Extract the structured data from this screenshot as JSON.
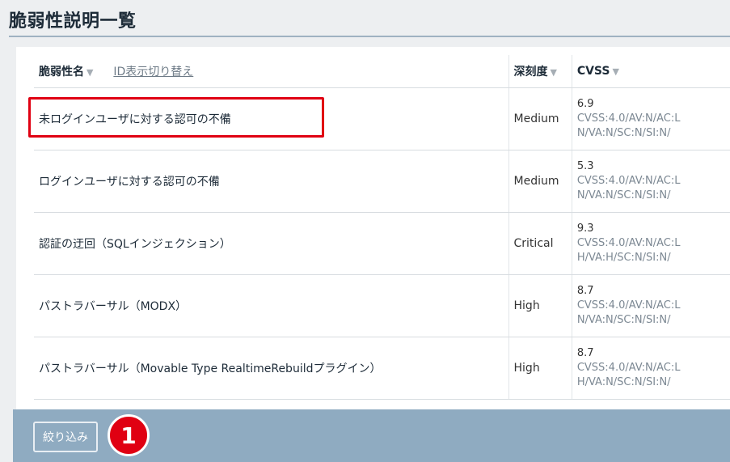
{
  "header": {
    "title": "脆弱性説明一覧"
  },
  "table": {
    "columns": {
      "name": "脆弱性名",
      "id_toggle": "ID表示切り替え",
      "severity": "深刻度",
      "cvss": "CVSS"
    },
    "sort_icon": "sort-caret-down-icon",
    "rows": [
      {
        "name": "未ログインユーザに対する認可の不備",
        "severity": "Medium",
        "score": "6.9",
        "vector_1": "CVSS:4.0/AV:N/AC:L",
        "vector_2": "N/VA:N/SC:N/SI:N/"
      },
      {
        "name": "ログインユーザに対する認可の不備",
        "severity": "Medium",
        "score": "5.3",
        "vector_1": "CVSS:4.0/AV:N/AC:L",
        "vector_2": "N/VA:N/SC:N/SI:N/"
      },
      {
        "name": "認証の迂回（SQLインジェクション）",
        "severity": "Critical",
        "score": "9.3",
        "vector_1": "CVSS:4.0/AV:N/AC:L",
        "vector_2": "H/VA:H/SC:N/SI:N/"
      },
      {
        "name": "パストラバーサル（MODX）",
        "severity": "High",
        "score": "8.7",
        "vector_1": "CVSS:4.0/AV:N/AC:L",
        "vector_2": "N/VA:N/SC:N/SI:N/"
      },
      {
        "name": "パストラバーサル（Movable Type RealtimeRebuildプラグイン）",
        "severity": "High",
        "score": "8.7",
        "vector_1": "CVSS:4.0/AV:N/AC:L",
        "vector_2": "H/VA:N/SC:N/SI:N/"
      }
    ]
  },
  "footer": {
    "filter_label": "絞り込み"
  },
  "annotation": {
    "step_number": "1",
    "highlight_color": "#e00012"
  },
  "colors": {
    "footer_bg": "#8fabc1",
    "title_rule": "#9fb2c2"
  }
}
